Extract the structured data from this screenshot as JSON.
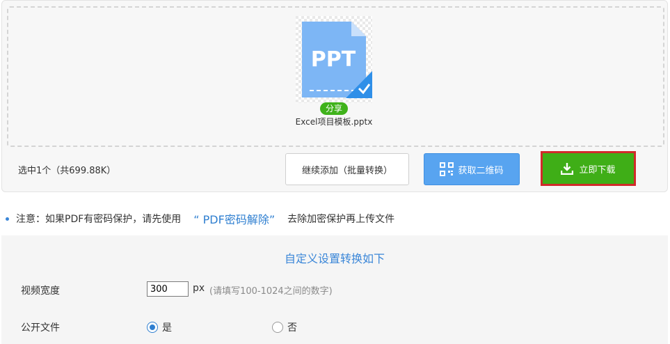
{
  "upload": {
    "thumb_text": "PPT",
    "share_badge": "分享",
    "file_name": "Excel项目模板.pptx",
    "selection_summary": "选中1个（共699.88K）"
  },
  "actions": {
    "continue_label": "继续添加（批量转换）",
    "qr_label": "获取二维码",
    "download_label": "立即下载"
  },
  "notice": {
    "prefix": "注意：如果PDF有密码保护，请先使用",
    "link": "“ PDF密码解除”",
    "suffix": "去除加密保护再上传文件"
  },
  "settings": {
    "title": "自定义设置转换如下",
    "video_width_label": "视频宽度",
    "video_width_value": "300",
    "unit": "px",
    "hint": "(请填写100-1024之间的数字)",
    "public_label": "公开文件",
    "option_yes": "是",
    "option_no": "否"
  },
  "colors": {
    "primary_blue": "#58a4f0",
    "download_green": "#3fae17",
    "highlight_red": "#d12a2a",
    "badge_green": "#3fb21b"
  },
  "icons": {
    "ppt_file": "ppt-file-icon",
    "qr": "qr-code-icon",
    "download": "download-icon"
  }
}
